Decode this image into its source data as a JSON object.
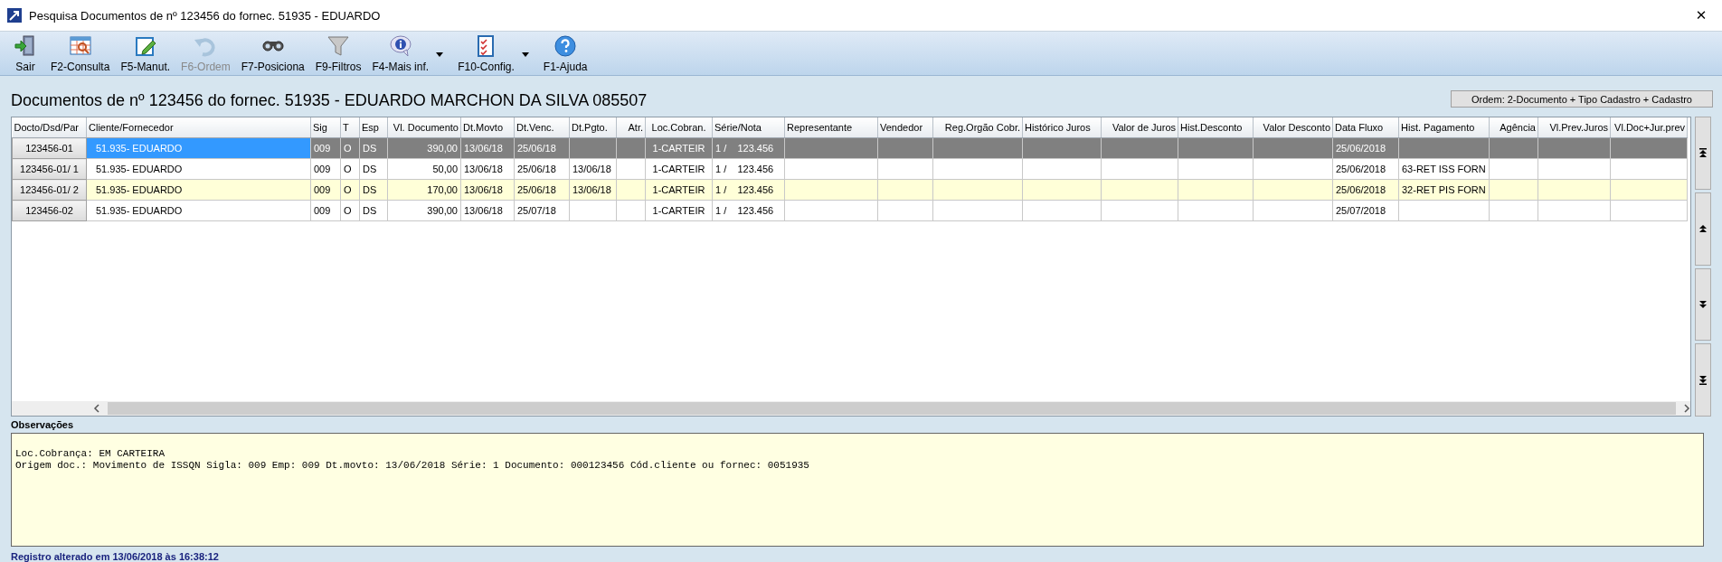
{
  "window": {
    "title": "Pesquisa Documentos de nº 123456 do fornec. 51935 - EDUARDO",
    "close": "✕"
  },
  "toolbar": [
    {
      "label": "Sair",
      "kind": "exit",
      "disabled": false,
      "has_menu": false
    },
    {
      "label": "F2-Consulta",
      "kind": "query",
      "disabled": false,
      "has_menu": false
    },
    {
      "label": "F5-Manut.",
      "kind": "edit",
      "disabled": false,
      "has_menu": false
    },
    {
      "label": "F6-Ordem",
      "kind": "undo",
      "disabled": true,
      "has_menu": false
    },
    {
      "label": "F7-Posiciona",
      "kind": "binoculars",
      "disabled": false,
      "has_menu": false
    },
    {
      "label": "F9-Filtros",
      "kind": "funnel",
      "disabled": false,
      "has_menu": false
    },
    {
      "label": "F4-Mais inf.",
      "kind": "info",
      "disabled": false,
      "has_menu": true
    },
    {
      "label": "F10-Config.",
      "kind": "checklist",
      "disabled": false,
      "has_menu": true
    },
    {
      "label": "F1-Ajuda",
      "kind": "help",
      "disabled": false,
      "has_menu": false
    }
  ],
  "heading": "Documentos de nº 123456 do fornec. 51935 - EDUARDO MARCHON DA SILVA 085507",
  "order_button": "Ordem: 2-Documento + Tipo Cadastro + Cadastro",
  "table": {
    "columns": [
      "Docto/Dsd/Par",
      "Cliente/Fornecedor",
      "Sig",
      "T",
      "Esp",
      "Vl. Documento",
      "Dt.Movto",
      "Dt.Venc.",
      "Dt.Pgto.",
      "Atr.",
      "Loc.Cobran.",
      "Série/Nota",
      "Representante",
      "Vendedor",
      "Reg.Orgão Cobr.",
      "Histórico Juros",
      "Valor de Juros",
      "Hist.Desconto",
      "Valor Desconto",
      "Data Fluxo",
      "Hist. Pagamento",
      "Agência",
      "Vl.Prev.Juros",
      "Vl.Doc+Jur.prev"
    ],
    "rows": [
      {
        "selected": true,
        "cells": [
          "123456-01",
          "51.935- EDUARDO",
          "009",
          "O",
          "DS",
          "390,00",
          "13/06/18",
          "25/06/18",
          null,
          null,
          "1-CARTEIR",
          "1 /    123.456",
          null,
          null,
          null,
          null,
          null,
          null,
          null,
          "25/06/2018",
          null,
          null,
          null,
          null
        ]
      },
      {
        "selected": false,
        "cells": [
          "123456-01/ 1",
          "51.935- EDUARDO",
          "009",
          "O",
          "DS",
          "50,00",
          "13/06/18",
          "25/06/18",
          "13/06/18",
          null,
          "1-CARTEIR",
          "1 /    123.456",
          null,
          null,
          null,
          null,
          null,
          null,
          null,
          "25/06/2018",
          "63-RET ISS FORN",
          null,
          null,
          null
        ]
      },
      {
        "selected": false,
        "cells": [
          "123456-01/ 2",
          "51.935- EDUARDO",
          "009",
          "O",
          "DS",
          "170,00",
          "13/06/18",
          "25/06/18",
          "13/06/18",
          null,
          "1-CARTEIR",
          "1 /    123.456",
          null,
          null,
          null,
          null,
          null,
          null,
          null,
          "25/06/2018",
          "32-RET PIS FORN",
          null,
          null,
          null
        ]
      },
      {
        "selected": false,
        "cells": [
          "123456-02",
          "51.935- EDUARDO",
          "009",
          "O",
          "DS",
          "390,00",
          "13/06/18",
          "25/07/18",
          null,
          null,
          "1-CARTEIR",
          "1 /    123.456",
          null,
          null,
          null,
          null,
          null,
          null,
          null,
          "25/07/2018",
          null,
          null,
          null,
          null
        ]
      }
    ]
  },
  "observations": {
    "label": "Observações",
    "lines": [
      "Loc.Cobrança: EM CARTEIRA",
      "Origem doc.: Movimento de ISSQN Sigla: 009 Emp: 009 Dt.movto: 13/06/2018 Série: 1 Documento: 000123456 Cód.cliente ou fornec: 0051935"
    ]
  },
  "status_bar": "Registro alterado em 13/06/2018 às 16:38:12"
}
